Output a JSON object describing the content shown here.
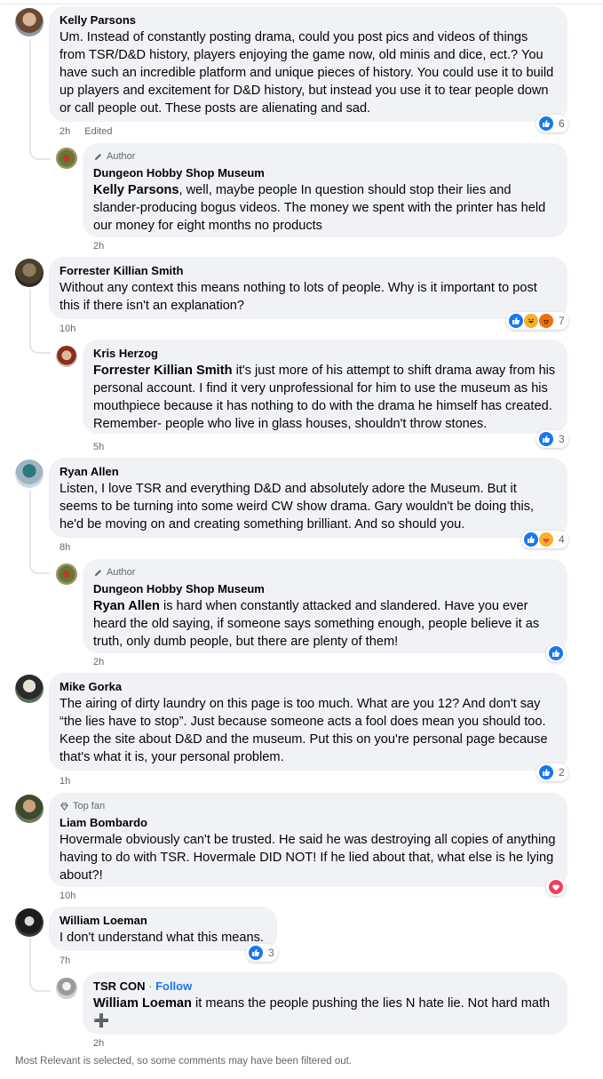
{
  "comments": [
    {
      "id": "c1",
      "author": "Kelly Parsons",
      "text": "Um. Instead of constantly posting drama, could you post pics and videos of things from TSR/D&D history, players enjoying the game now, old minis and dice, ect.? You have such an incredible platform and unique pieces of history. You could use it to build up players and excitement for D&D history, but instead you use it to tear people down or call people out. These posts are alienating and sad.",
      "time": "2h",
      "edited": "Edited",
      "reaction_count": "6"
    },
    {
      "id": "r1",
      "badge": "Author",
      "author": "Dungeon Hobby Shop Museum",
      "mention": "Kelly Parsons",
      "text": ", well, maybe people In question should stop their lies and slander-producing bogus videos. The money we spent with the printer has held our money for eight months no products",
      "time": "2h"
    },
    {
      "id": "c2",
      "author": "Forrester Killian Smith",
      "text": "Without any context this means nothing to lots of people. Why is it important to post this if there isn't an explanation?",
      "time": "10h",
      "reaction_count": "7"
    },
    {
      "id": "r2",
      "author": "Kris Herzog",
      "mention": "Forrester Killian Smith",
      "text": " it's just more of his attempt to shift drama away from his personal account. I find it very unprofessional for him to use the museum as his mouthpiece because it has nothing to do with the drama he himself has created. Remember- people who live in glass houses, shouldn't throw stones.",
      "time": "5h",
      "reaction_count": "3"
    },
    {
      "id": "c3",
      "author": "Ryan Allen",
      "text": "Listen, I love TSR and everything D&D and absolutely adore the Museum. But it seems to be turning into some weird CW show drama. Gary wouldn't be doing this, he'd be moving on and creating something brilliant. And so should you.",
      "time": "8h",
      "reaction_count": "4"
    },
    {
      "id": "r3",
      "badge": "Author",
      "author": "Dungeon Hobby Shop Museum",
      "mention": "Ryan Allen",
      "text": " is hard when constantly attacked and slandered. Have you ever heard the old saying, if someone says something enough, people believe it as truth, only dumb people, but there are plenty of them!",
      "time": "2h"
    },
    {
      "id": "c4",
      "author": "Mike Gorka",
      "text": "The airing of dirty laundry on this page is too much. What are you 12? And don't say “the lies have to stop”. Just because someone acts a fool does mean you should too. Keep the site about D&D and the museum. Put this on you're personal page because that's what it is, your personal problem.",
      "time": "1h",
      "reaction_count": "2"
    },
    {
      "id": "c5",
      "badge": "Top fan",
      "author": "Liam Bombardo",
      "text": "Hovermale obviously can't be trusted. He said he was destroying all copies of anything having to do with TSR. Hovermale DID NOT! If he lied about that, what else is he lying about?!",
      "time": "10h"
    },
    {
      "id": "c6",
      "author": "William Loeman",
      "text": "I don't understand what this means.",
      "time": "7h",
      "reaction_count": "3"
    },
    {
      "id": "r6",
      "author": "TSR CON",
      "follow_sep": " · ",
      "follow": "Follow",
      "mention": "William Loeman",
      "text": " it means the people pushing the lies N hate lie. Not hard math ➕",
      "time": "2h"
    }
  ],
  "footer": "Most Relevant is selected, so some comments may have been filtered out.",
  "colors": {
    "bubble": "#f0f2f5",
    "like": "#1877f2",
    "love": "#f33e58",
    "haha": "#f7b125",
    "angry": "#e9710f",
    "meta": "#65676b"
  }
}
